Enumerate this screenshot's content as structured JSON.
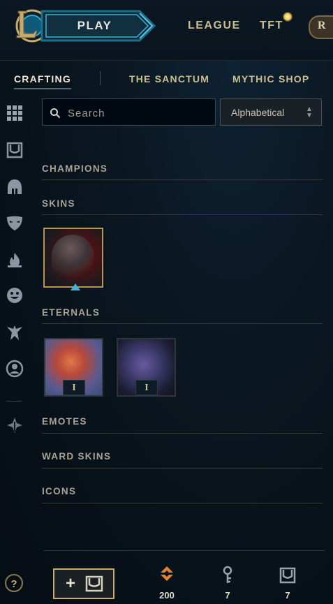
{
  "topbar": {
    "play_label": "PLAY",
    "nav": [
      "LEAGUE",
      "TFT"
    ],
    "logo_letter": "L",
    "corner_letter": "R"
  },
  "subnav": {
    "crafting": "CRAFTING",
    "sanctum": "THE SANCTUM",
    "mythic": "MYTHIC SHOP"
  },
  "search": {
    "placeholder": "Search",
    "value": ""
  },
  "sort": {
    "selected": "Alphabetical"
  },
  "sidebar": {
    "icons": [
      "grid-icon",
      "chest-icon",
      "helmet-icon",
      "mask-icon",
      "flame-icon",
      "emote-icon",
      "ward-icon",
      "profile-icon",
      "loot-icon"
    ],
    "help_label": "?"
  },
  "sections": {
    "champions": "CHAMPIONS",
    "skins": "SKINS",
    "eternals": "ETERNALS",
    "emotes": "EMOTES",
    "ward_skins": "WARD SKINS",
    "icons": "ICONS"
  },
  "eternals": [
    {
      "badge": "I"
    },
    {
      "badge": "I"
    }
  ],
  "footer": {
    "add_plus": "+",
    "currencies": [
      {
        "icon": "orange-essence-icon",
        "value": "200"
      },
      {
        "icon": "key-icon",
        "value": "7"
      },
      {
        "icon": "chest-icon",
        "value": "7"
      }
    ]
  },
  "colors": {
    "gold": "#c8aa6e",
    "orange_essence": "#e8822a",
    "accent_blue": "#3fb5d8"
  }
}
